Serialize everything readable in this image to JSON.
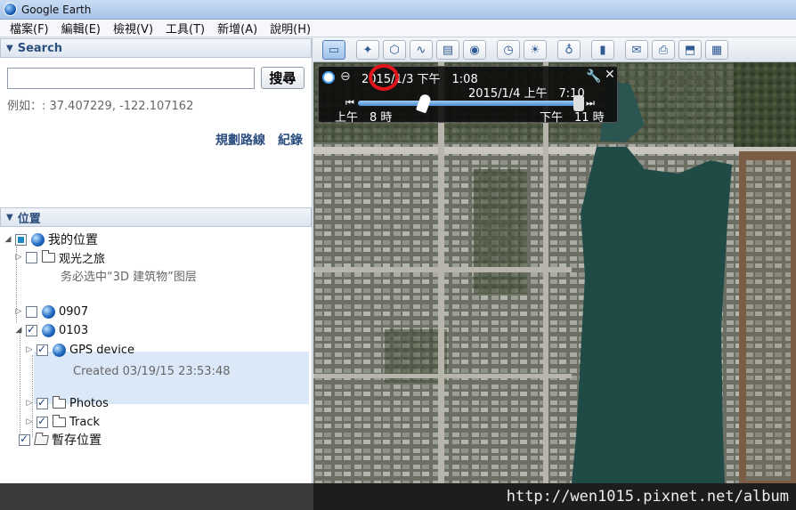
{
  "window": {
    "title": "Google Earth"
  },
  "menu": [
    "檔案(F)",
    "編輯(E)",
    "檢視(V)",
    "工具(T)",
    "新增(A)",
    "說明(H)"
  ],
  "search": {
    "header": "Search",
    "input_value": "",
    "button": "搜尋",
    "hint": "例如：: 37.407229, -122.107162",
    "link_route": "規劃路線",
    "link_history": "紀錄"
  },
  "places": {
    "header": "位置",
    "my_places": "我的位置",
    "tour_folder": "观光之旅",
    "tour_note": "务必选中“3D 建筑物”图层",
    "item_0907": "0907",
    "item_0103": "0103",
    "gps_device": "GPS device",
    "gps_created": "Created 03/19/15 23:53:48",
    "photos": "Photos",
    "track": "Track",
    "temp_places": "暫存位置"
  },
  "time_slider": {
    "start_label": "2015/1/3 下午　1:08",
    "current_label": "2015/1/4 上午　7:10",
    "range_start": "上午　8 時",
    "range_end": "下午　11 時"
  },
  "watermark": "http://wen1015.pixnet.net/album",
  "toolbar_icons": [
    "sidebar-toggle-icon",
    "placemark-icon",
    "polygon-icon",
    "path-icon",
    "image-overlay-icon",
    "record-tour-icon",
    "historical-imagery-icon",
    "sunlight-icon",
    "planet-icon",
    "ruler-icon",
    "email-icon",
    "print-icon",
    "save-image-icon",
    "view-in-maps-icon"
  ]
}
